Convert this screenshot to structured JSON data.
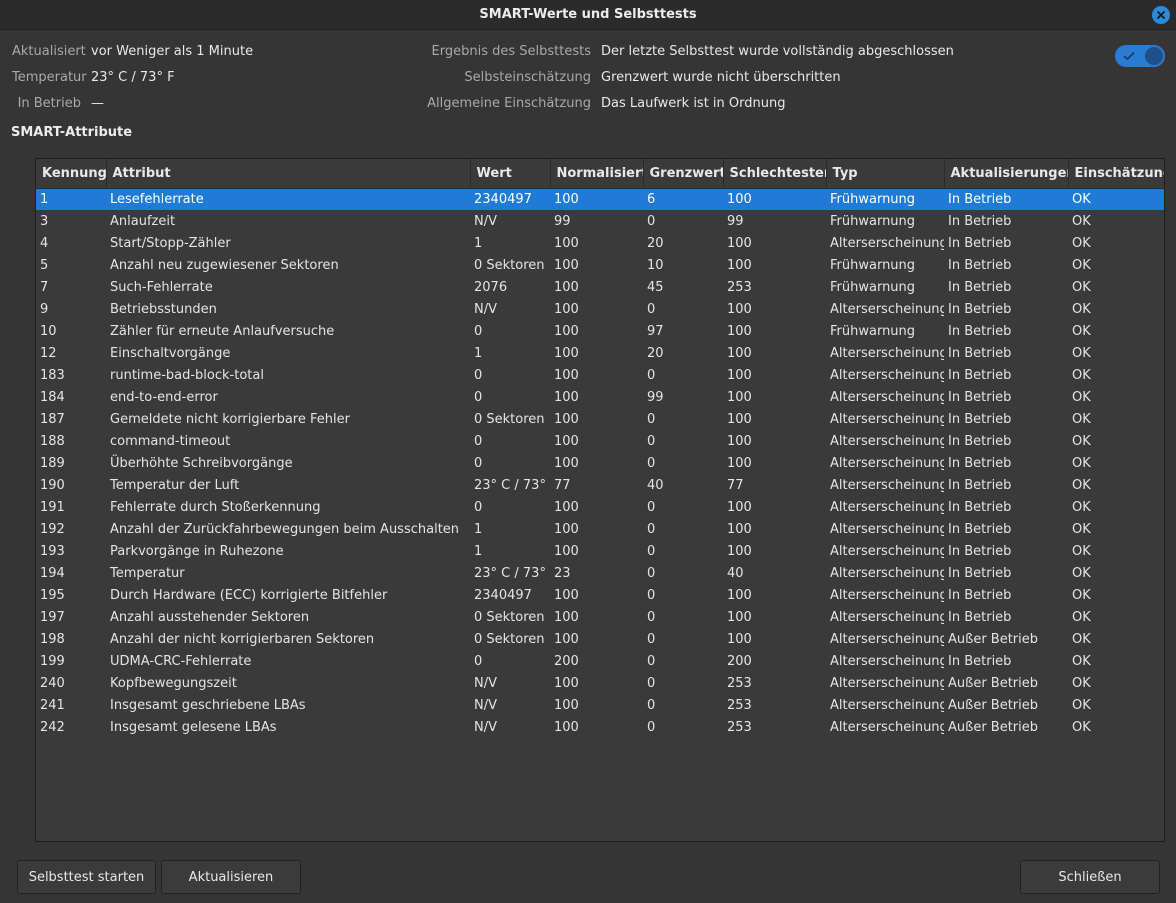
{
  "window": {
    "title": "SMART-Werte und Selbsttests"
  },
  "info": {
    "updated_label": "Aktualisiert",
    "updated_value": "vor Weniger als 1 Minute",
    "temperature_label": "Temperatur",
    "temperature_value": "23° C / 73° F",
    "powered_label": "In Betrieb",
    "powered_value": "—",
    "selftest_result_label": "Ergebnis des Selbsttests",
    "selftest_result_value": "Der letzte Selbsttest wurde vollständig abgeschlossen",
    "self_assessment_label": "Selbsteinschätzung",
    "self_assessment_value": "Grenzwert wurde nicht überschritten",
    "overall_assessment_label": "Allgemeine Einschätzung",
    "overall_assessment_value": "Das Laufwerk ist in Ordnung",
    "toggle_state": "on"
  },
  "section_title": "SMART-Attribute",
  "table": {
    "headers": [
      "Kennung",
      "Attribut",
      "Wert",
      "Normalisiert",
      "Grenzwert",
      "Schlechtester",
      "Typ",
      "Aktualisierungen",
      "Einschätzung"
    ],
    "rows": [
      [
        "1",
        "Lesefehlerrate",
        "2340497",
        "100",
        "6",
        "100",
        "Frühwarnung",
        "In Betrieb",
        "OK"
      ],
      [
        "3",
        "Anlaufzeit",
        "N/V",
        "99",
        "0",
        "99",
        "Frühwarnung",
        "In Betrieb",
        "OK"
      ],
      [
        "4",
        "Start/Stopp-Zähler",
        "1",
        "100",
        "20",
        "100",
        "Alterserscheinung",
        "In Betrieb",
        "OK"
      ],
      [
        "5",
        "Anzahl neu zugewiesener Sektoren",
        "0 Sektoren",
        "100",
        "10",
        "100",
        "Frühwarnung",
        "In Betrieb",
        "OK"
      ],
      [
        "7",
        "Such-Fehlerrate",
        "2076",
        "100",
        "45",
        "253",
        "Frühwarnung",
        "In Betrieb",
        "OK"
      ],
      [
        "9",
        "Betriebsstunden",
        "N/V",
        "100",
        "0",
        "100",
        "Alterserscheinung",
        "In Betrieb",
        "OK"
      ],
      [
        "10",
        "Zähler für erneute Anlaufversuche",
        "0",
        "100",
        "97",
        "100",
        "Frühwarnung",
        "In Betrieb",
        "OK"
      ],
      [
        "12",
        "Einschaltvorgänge",
        "1",
        "100",
        "20",
        "100",
        "Alterserscheinung",
        "In Betrieb",
        "OK"
      ],
      [
        "183",
        "runtime-bad-block-total",
        "0",
        "100",
        "0",
        "100",
        "Alterserscheinung",
        "In Betrieb",
        "OK"
      ],
      [
        "184",
        "end-to-end-error",
        "0",
        "100",
        "99",
        "100",
        "Alterserscheinung",
        "In Betrieb",
        "OK"
      ],
      [
        "187",
        "Gemeldete nicht korrigierbare Fehler",
        "0 Sektoren",
        "100",
        "0",
        "100",
        "Alterserscheinung",
        "In Betrieb",
        "OK"
      ],
      [
        "188",
        "command-timeout",
        "0",
        "100",
        "0",
        "100",
        "Alterserscheinung",
        "In Betrieb",
        "OK"
      ],
      [
        "189",
        "Überhöhte Schreibvorgänge",
        "0",
        "100",
        "0",
        "100",
        "Alterserscheinung",
        "In Betrieb",
        "OK"
      ],
      [
        "190",
        "Temperatur der Luft",
        "23° C / 73° F",
        "77",
        "40",
        "77",
        "Alterserscheinung",
        "In Betrieb",
        "OK"
      ],
      [
        "191",
        "Fehlerrate durch Stoßerkennung",
        "0",
        "100",
        "0",
        "100",
        "Alterserscheinung",
        "In Betrieb",
        "OK"
      ],
      [
        "192",
        "Anzahl der Zurückfahrbewegungen beim Ausschalten",
        "1",
        "100",
        "0",
        "100",
        "Alterserscheinung",
        "In Betrieb",
        "OK"
      ],
      [
        "193",
        "Parkvorgänge in Ruhezone",
        "1",
        "100",
        "0",
        "100",
        "Alterserscheinung",
        "In Betrieb",
        "OK"
      ],
      [
        "194",
        "Temperatur",
        "23° C / 73° F",
        "23",
        "0",
        "40",
        "Alterserscheinung",
        "In Betrieb",
        "OK"
      ],
      [
        "195",
        "Durch Hardware (ECC) korrigierte Bitfehler",
        "2340497",
        "100",
        "0",
        "100",
        "Alterserscheinung",
        "In Betrieb",
        "OK"
      ],
      [
        "197",
        "Anzahl ausstehender Sektoren",
        "0 Sektoren",
        "100",
        "0",
        "100",
        "Alterserscheinung",
        "In Betrieb",
        "OK"
      ],
      [
        "198",
        "Anzahl der nicht korrigierbaren Sektoren",
        "0 Sektoren",
        "100",
        "0",
        "100",
        "Alterserscheinung",
        "Außer Betrieb",
        "OK"
      ],
      [
        "199",
        "UDMA-CRC-Fehlerrate",
        "0",
        "200",
        "0",
        "200",
        "Alterserscheinung",
        "In Betrieb",
        "OK"
      ],
      [
        "240",
        "Kopfbewegungszeit",
        "N/V",
        "100",
        "0",
        "253",
        "Alterserscheinung",
        "Außer Betrieb",
        "OK"
      ],
      [
        "241",
        "Insgesamt geschriebene LBAs",
        "N/V",
        "100",
        "0",
        "253",
        "Alterserscheinung",
        "Außer Betrieb",
        "OK"
      ],
      [
        "242",
        "Insgesamt gelesene LBAs",
        "N/V",
        "100",
        "0",
        "253",
        "Alterserscheinung",
        "Außer Betrieb",
        "OK"
      ]
    ],
    "selected_row": 0
  },
  "buttons": {
    "start_selftest": "Selbsttest starten",
    "refresh": "Aktualisieren",
    "close": "Schließen"
  },
  "colors": {
    "accent": "#1f7bd6",
    "background": "#353535"
  }
}
